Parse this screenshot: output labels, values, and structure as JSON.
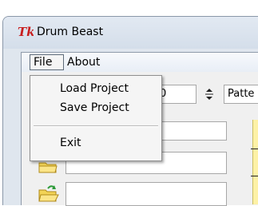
{
  "window": {
    "title": "Drum Beast"
  },
  "menubar": {
    "file": "File",
    "about": "About"
  },
  "file_menu": {
    "load": "Load Project",
    "save": "Save Project",
    "exit": "Exit"
  },
  "controls": {
    "spin_value": "0",
    "pattern_label": "Patte"
  },
  "icons": {
    "app": "tk-feather-icon",
    "folder": "folder-icon",
    "folder_open": "open-folder-icon"
  },
  "colors": {
    "accent_yellow": "#fdf1a6",
    "menu_border": "#5e6b7a"
  }
}
